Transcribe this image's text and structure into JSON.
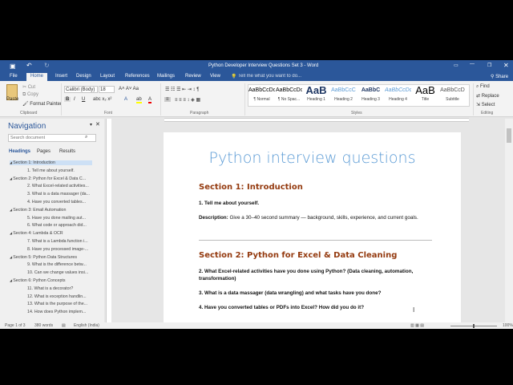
{
  "window": {
    "title": "Python Developer Interview Questions Set 3 - Word"
  },
  "tabs": [
    {
      "label": "File"
    },
    {
      "label": "Home"
    },
    {
      "label": "Insert"
    },
    {
      "label": "Design"
    },
    {
      "label": "Layout"
    },
    {
      "label": "References"
    },
    {
      "label": "Mailings"
    },
    {
      "label": "Review"
    },
    {
      "label": "View"
    }
  ],
  "tell_me": "Tell me what you want to do...",
  "share": "Share",
  "clipboard": {
    "paste": "Paste",
    "cut": "Cut",
    "copy": "Copy",
    "format_painter": "Format Painter",
    "label": "Clipboard"
  },
  "font": {
    "name": "Calibri (Body)",
    "size": "18",
    "label": "Font"
  },
  "paragraph": {
    "label": "Paragraph"
  },
  "styles": {
    "label": "Styles",
    "items": [
      {
        "preview": "AaBbCcDc",
        "name": "¶ Normal"
      },
      {
        "preview": "AaBbCcDc",
        "name": "¶ No Spac..."
      },
      {
        "preview": "AaB",
        "name": "Heading 1"
      },
      {
        "preview": "AaBbCcC",
        "name": "Heading 2"
      },
      {
        "preview": "AaBbC",
        "name": "Heading 3"
      },
      {
        "preview": "AaBbCcDc",
        "name": "Heading 4"
      },
      {
        "preview": "AaB",
        "name": "Title"
      },
      {
        "preview": "AaBbCcD",
        "name": "Subtitle"
      }
    ]
  },
  "editing": {
    "find": "Find",
    "replace": "Replace",
    "select": "Select",
    "label": "Editing"
  },
  "navigation": {
    "title": "Navigation",
    "search_placeholder": "Search document",
    "tabs": [
      "Headings",
      "Pages",
      "Results"
    ],
    "items": [
      {
        "text": "Section 1: Introduction",
        "level": 1,
        "selected": true
      },
      {
        "text": "1. Tell me about yourself.",
        "level": 2
      },
      {
        "text": "Section 2: Python for Excel & Data C...",
        "level": 1
      },
      {
        "text": "2. What Excel-related activities...",
        "level": 2
      },
      {
        "text": "3. What is a data massager (da...",
        "level": 2
      },
      {
        "text": "4. Have you converted tables...",
        "level": 2
      },
      {
        "text": "Section 3: Email Automation",
        "level": 1
      },
      {
        "text": "5. Have you done mailing aut...",
        "level": 2
      },
      {
        "text": "6. What code or approach did...",
        "level": 2
      },
      {
        "text": "Section 4: Lambda & OCR",
        "level": 1
      },
      {
        "text": "7. What is a Lambda function i...",
        "level": 2
      },
      {
        "text": "8. Have you processed image-...",
        "level": 2
      },
      {
        "text": "Section 5: Python Data Structures",
        "level": 1
      },
      {
        "text": "9. What is the difference betw...",
        "level": 2
      },
      {
        "text": "10. Can we change values insi...",
        "level": 2
      },
      {
        "text": "Section 6: Python Concepts",
        "level": 1
      },
      {
        "text": "11. What is a decorator?",
        "level": 2
      },
      {
        "text": "12. What is exception handlin...",
        "level": 2
      },
      {
        "text": "13. What is the purpose of the...",
        "level": 2
      },
      {
        "text": "14. How does Python implem...",
        "level": 2
      }
    ]
  },
  "document": {
    "title": "Python interview questions",
    "s1": "Section 1: Introduction",
    "q1": "1. Tell me about yourself.",
    "desc_label": "Description:",
    "desc_text": " Give a 30–40 second summary — background, skills, experience, and current goals.",
    "s2": "Section 2: Python for Excel & Data Cleaning",
    "q2": "2. What Excel-related activities have you done using Python? (Data cleaning, automation, transformation)",
    "q3": "3. What is a data massager (data wrangling) and what tasks have you done?",
    "q4": "4. Have you converted tables or PDFs into Excel? How did you do it?"
  },
  "status": {
    "page": "Page 1 of 3",
    "words": "380 words",
    "language": "English (India)",
    "zoom": "100%"
  },
  "colors": {
    "accent": "#2b579a",
    "heading": "#943a0f",
    "title": "#5b9bd5"
  }
}
